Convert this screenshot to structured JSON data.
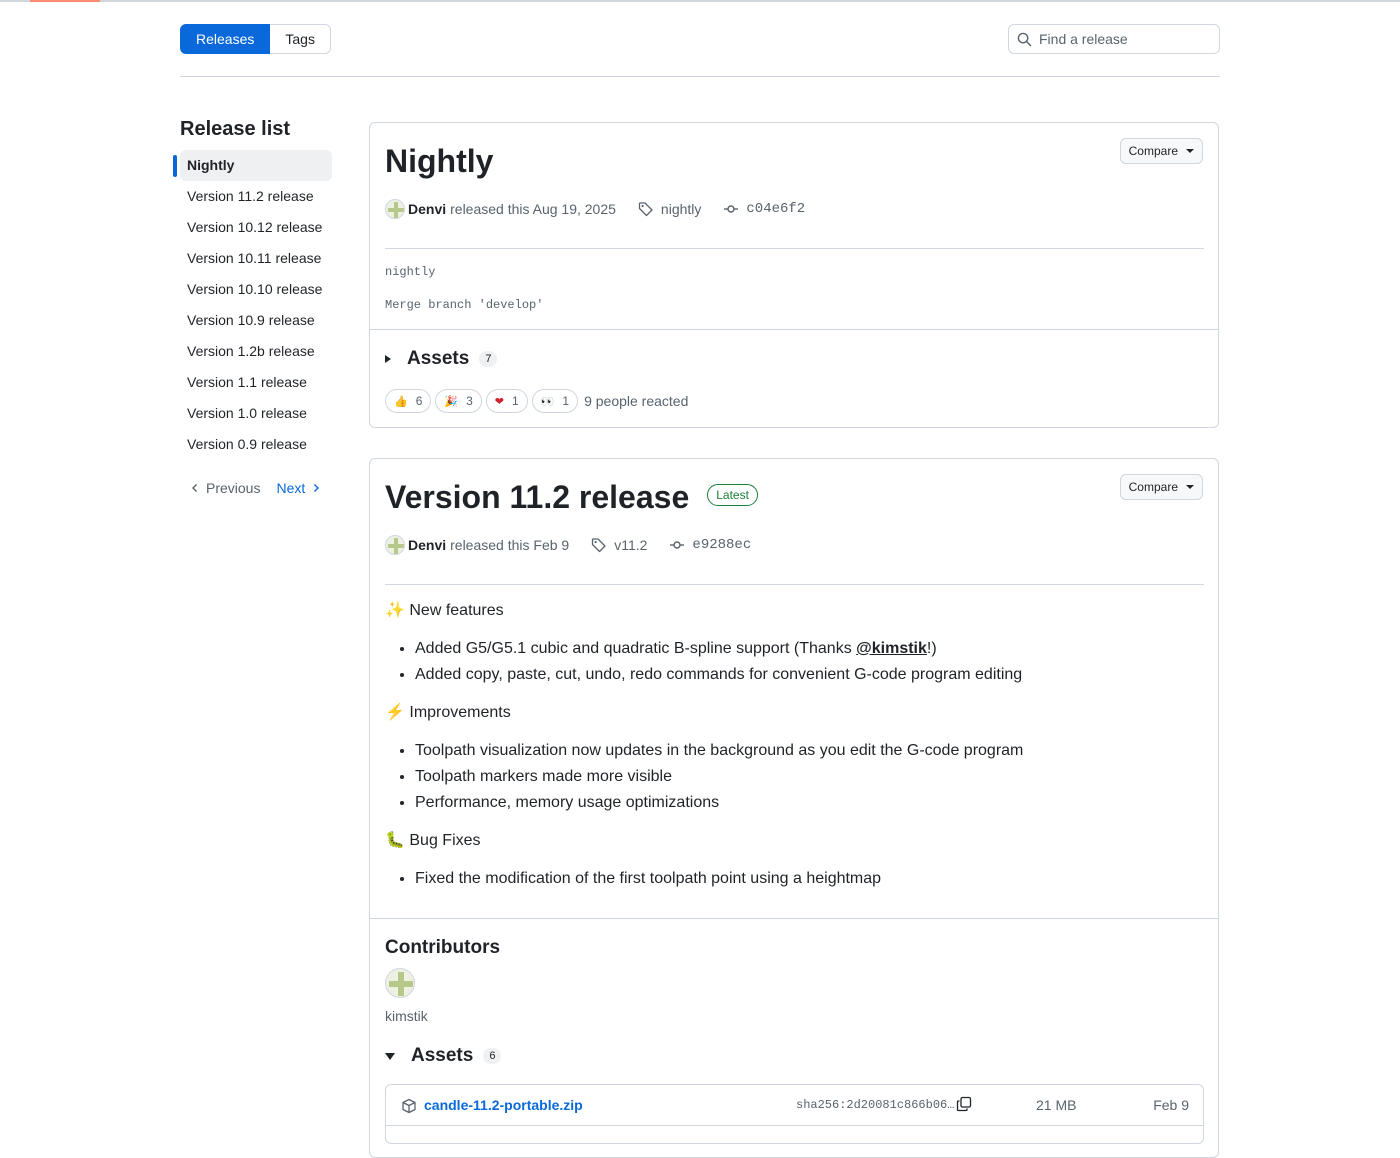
{
  "tabs": {
    "releases": "Releases",
    "tags": "Tags"
  },
  "search": {
    "placeholder": "Find a release"
  },
  "sidebar": {
    "title": "Release list",
    "items": [
      {
        "label": "Nightly",
        "active": true
      },
      {
        "label": "Version 11.2 release"
      },
      {
        "label": "Version 10.12 release"
      },
      {
        "label": "Version 10.11 release"
      },
      {
        "label": "Version 10.10 release"
      },
      {
        "label": "Version 10.9 release"
      },
      {
        "label": "Version 1.2b release"
      },
      {
        "label": "Version 1.1 release"
      },
      {
        "label": "Version 1.0 release"
      },
      {
        "label": "Version 0.9 release"
      }
    ],
    "previous": "Previous",
    "next": "Next"
  },
  "releases": [
    {
      "title": "Nightly",
      "compare": "Compare",
      "author": "Denvi",
      "released_text": "released this Aug 19, 2025",
      "tag": "nightly",
      "commit": "c04e6f2",
      "notes": [
        "nightly",
        "Merge branch 'develop'"
      ],
      "assets_label": "Assets",
      "assets_count": "7",
      "reactions": [
        {
          "icon": "thumbs-up-icon",
          "emoji": "👍",
          "count": "6"
        },
        {
          "icon": "party-popper-icon",
          "emoji": "🎉",
          "count": "3"
        },
        {
          "icon": "heart-icon",
          "emoji": "❤",
          "count": "1"
        },
        {
          "icon": "eyes-icon",
          "emoji": "👀",
          "count": "1"
        }
      ],
      "reacted_text": "9 people reacted"
    },
    {
      "title": "Version 11.2 release",
      "badge": "Latest",
      "compare": "Compare",
      "author": "Denvi",
      "released_text": "released this Feb 9",
      "tag": "v11.2",
      "commit": "e9288ec",
      "sections": [
        {
          "emoji": "✨",
          "heading": "New features",
          "items": [
            {
              "before": "Added G5/G5.1 cubic and quadratic B-spline support (Thanks ",
              "mention": "@kimstik",
              "after": "!)"
            },
            {
              "before": "Added copy, paste, cut, undo, redo commands for convenient G-code program editing"
            }
          ]
        },
        {
          "emoji": "⚡",
          "heading": "Improvements",
          "items": [
            {
              "before": "Toolpath visualization now updates in the background as you edit the G-code program"
            },
            {
              "before": "Toolpath markers made more visible"
            },
            {
              "before": "Performance, memory usage optimizations"
            }
          ]
        },
        {
          "emoji": "🐛",
          "heading": "Bug Fixes",
          "items": [
            {
              "before": "Fixed the modification of the first toolpath point using a heightmap"
            }
          ]
        }
      ],
      "contributors_label": "Contributors",
      "contributor": "kimstik",
      "assets_label": "Assets",
      "assets_count": "6",
      "assets": [
        {
          "name": "candle-11.2-portable.zip",
          "sha": "sha256:2d20081c866b06…",
          "size": "21 MB",
          "date": "Feb 9"
        }
      ]
    }
  ],
  "colors": {
    "accent": "#0969da",
    "latest": "#1a7f37",
    "border": "#d0d7de"
  }
}
